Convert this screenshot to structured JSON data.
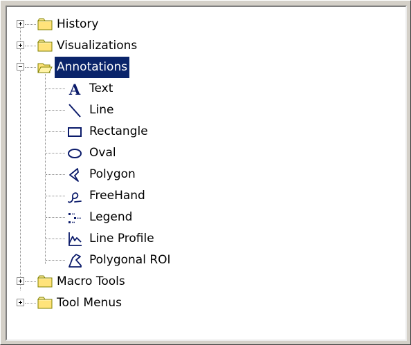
{
  "tree": {
    "top_items": [
      {
        "label": "History",
        "expanded": false
      },
      {
        "label": "Visualizations",
        "expanded": false
      },
      {
        "label": "Annotations",
        "expanded": true,
        "selected": true
      },
      {
        "label": "Macro Tools",
        "expanded": false
      },
      {
        "label": "Tool Menus",
        "expanded": false
      }
    ],
    "annotation_children": [
      {
        "label": "Text",
        "icon": "text-A-icon"
      },
      {
        "label": "Line",
        "icon": "line-icon"
      },
      {
        "label": "Rectangle",
        "icon": "rectangle-icon"
      },
      {
        "label": "Oval",
        "icon": "oval-icon"
      },
      {
        "label": "Polygon",
        "icon": "polygon-icon"
      },
      {
        "label": "FreeHand",
        "icon": "freehand-icon"
      },
      {
        "label": "Legend",
        "icon": "legend-icon"
      },
      {
        "label": "Line Profile",
        "icon": "line-profile-icon"
      },
      {
        "label": "Polygonal ROI",
        "icon": "polygonal-roi-icon"
      }
    ]
  },
  "colors": {
    "selection_bg": "#0a246a",
    "selection_fg": "#ffffff",
    "folder_fill": "#ffe37a"
  }
}
